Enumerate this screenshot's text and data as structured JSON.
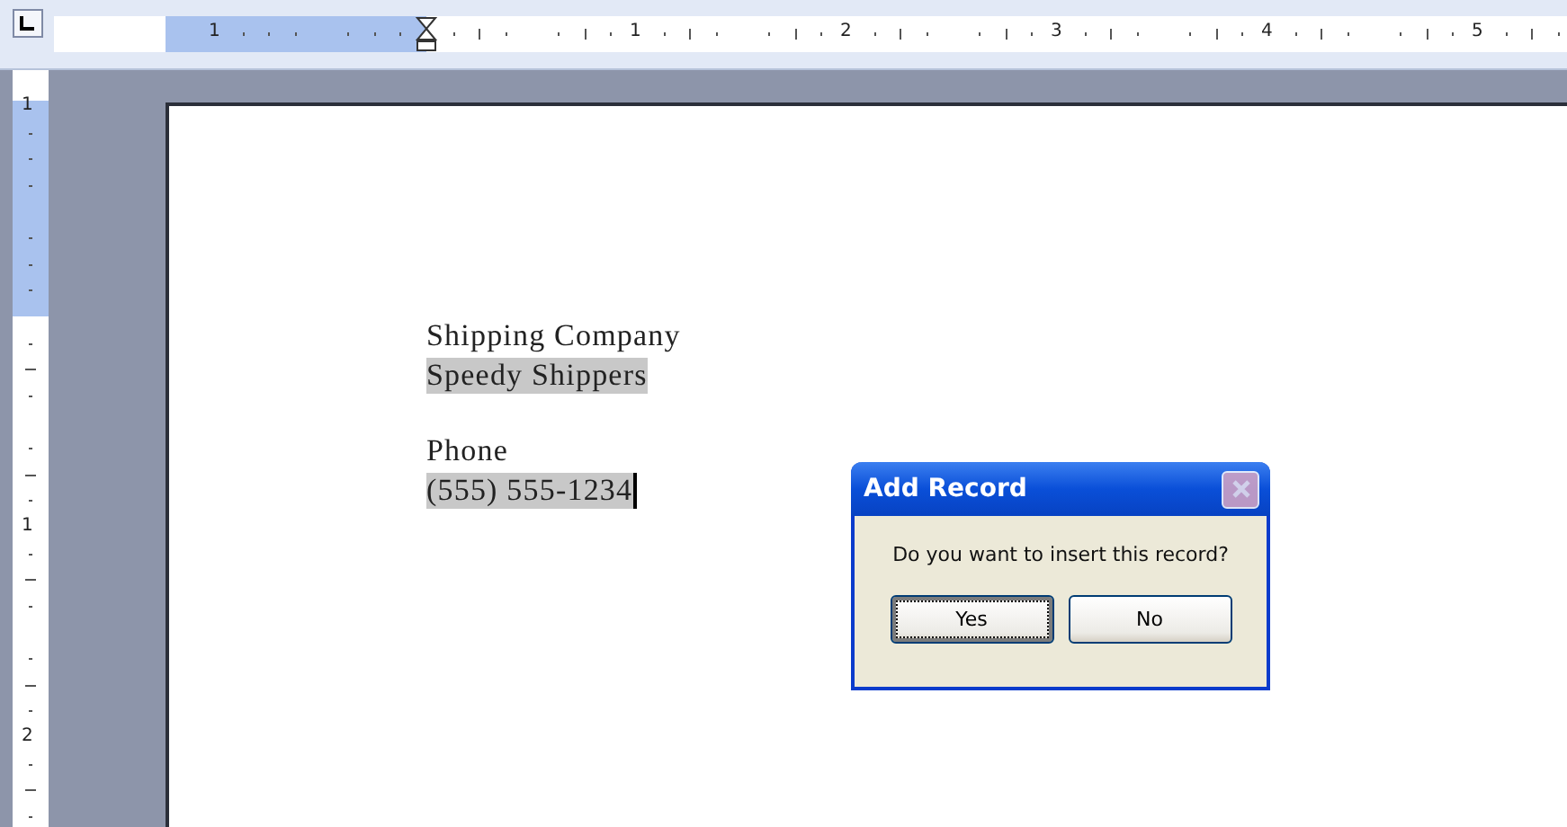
{
  "horizontal_ruler": {
    "numbers": [
      "1",
      "1",
      "2",
      "3",
      "4",
      "5"
    ]
  },
  "vertical_ruler": {
    "numbers": [
      "1",
      "1",
      "2"
    ]
  },
  "document": {
    "blocks": [
      {
        "label": "Shipping Company",
        "value": "Speedy Shippers",
        "cursor": false
      },
      {
        "label": "Phone",
        "value": "(555) 555-1234",
        "cursor": true
      }
    ]
  },
  "dialog": {
    "title": "Add Record",
    "message": "Do you want to insert this record?",
    "buttons": [
      {
        "label": "Yes",
        "focused": true
      },
      {
        "label": "No",
        "focused": false
      }
    ]
  }
}
